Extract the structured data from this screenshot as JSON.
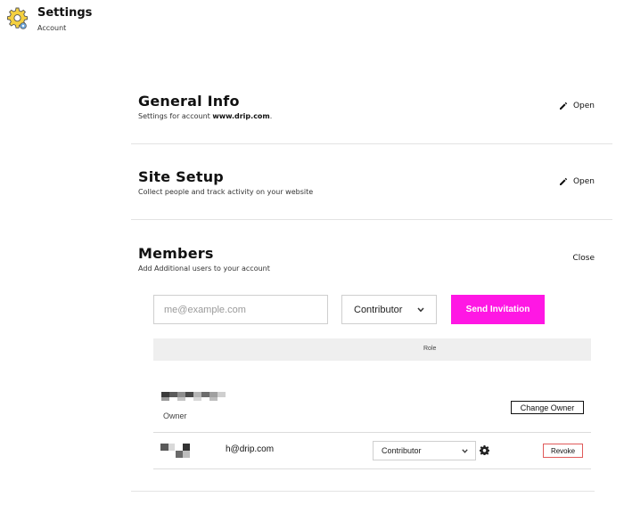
{
  "app": {
    "title": "Settings",
    "subtitle": "Account",
    "logo_icon": "gear-icon"
  },
  "sections": [
    {
      "title": "General Info",
      "description_prefix": "Settings for account ",
      "description_bold": "www.drip.com",
      "description_suffix": ".",
      "action_label": "Open",
      "action_icon": "pencil-icon"
    },
    {
      "title": "Site Setup",
      "description": "Collect people and track activity on your website",
      "action_label": "Open",
      "action_icon": "pencil-icon"
    },
    {
      "title": "Members",
      "description": "Add Additional users to your account",
      "action_label": "Close"
    }
  ],
  "invite": {
    "email_placeholder": "me@example.com",
    "email_value": "",
    "role_selected": "Contributor",
    "send_label": "Send Invitation"
  },
  "members_table": {
    "header_role": "Role",
    "rows": [
      {
        "name": "[redacted]",
        "role_label": "Owner",
        "action_label": "Change Owner"
      },
      {
        "name": "[redacted]",
        "email": "h@drip.com",
        "role_selected": "Contributor",
        "action_label": "Revoke"
      }
    ]
  },
  "colors": {
    "accent": "#ff17e4",
    "revoke_border": "#e05a5a",
    "divider": "#e3e3e3",
    "table_header_bg": "#efefef"
  }
}
